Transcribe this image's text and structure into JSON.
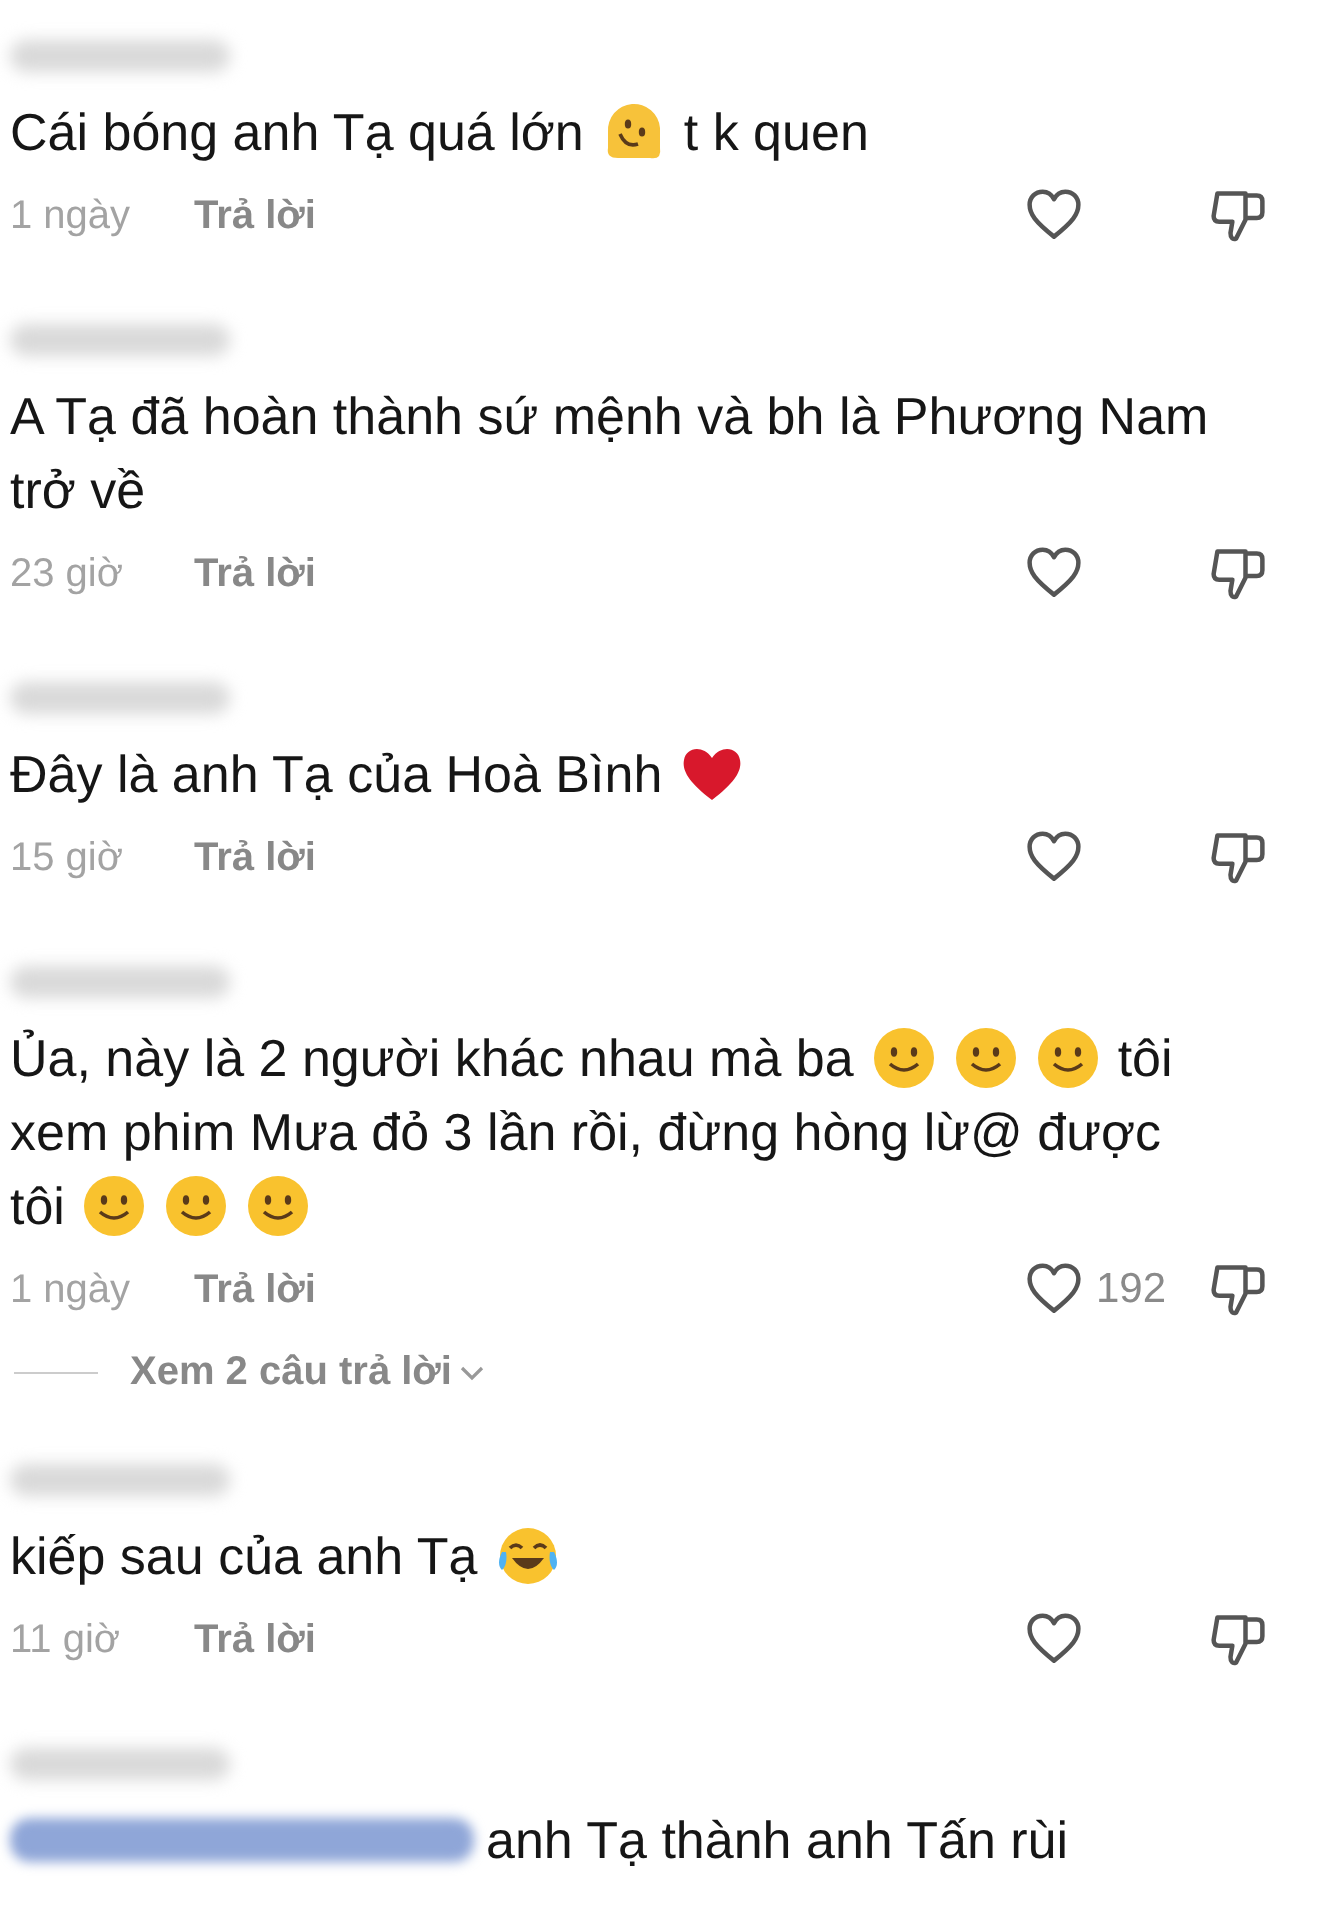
{
  "comments": [
    {
      "lines": [
        [
          {
            "kind": "text",
            "text": "Cái bóng anh Tạ quá lớn"
          },
          {
            "kind": "melting-face"
          },
          {
            "kind": "text",
            "text": "t k quen"
          }
        ]
      ],
      "time": "1 ngày",
      "reply": "Trả lời"
    },
    {
      "lines": [
        [
          {
            "kind": "text",
            "text": "A Tạ đã hoàn thành sứ mệnh và bh là Phương Nam"
          }
        ],
        [
          {
            "kind": "text",
            "text": "trở về"
          }
        ]
      ],
      "time": "23 giờ",
      "reply": "Trả lời"
    },
    {
      "lines": [
        [
          {
            "kind": "text",
            "text": "Đây là anh Tạ của Hoà Bình"
          },
          {
            "kind": "heart"
          }
        ]
      ],
      "time": "15 giờ",
      "reply": "Trả lời"
    },
    {
      "lines": [
        [
          {
            "kind": "text",
            "text": "Ủa, này là 2 người khác nhau mà ba"
          },
          {
            "kind": "smiley"
          },
          {
            "kind": "smiley"
          },
          {
            "kind": "smiley"
          },
          {
            "kind": "text",
            "text": "tôi"
          }
        ],
        [
          {
            "kind": "text",
            "text": "xem phim Mưa đỏ 3 lần rồi, đừng hòng lừ@ được"
          }
        ],
        [
          {
            "kind": "text",
            "text": "tôi"
          },
          {
            "kind": "smiley"
          },
          {
            "kind": "smiley"
          },
          {
            "kind": "smiley"
          }
        ]
      ],
      "time": "1 ngày",
      "reply": "Trả lời",
      "likes": "192",
      "view_replies": "Xem 2 câu trả lời"
    },
    {
      "lines": [
        [
          {
            "kind": "text",
            "text": "kiếp sau của anh Tạ"
          },
          {
            "kind": "laughing-face"
          }
        ]
      ],
      "time": "11 giờ",
      "reply": "Trả lời"
    },
    {
      "lines": [
        [
          {
            "kind": "blurred-mention"
          },
          {
            "kind": "text",
            "text": "anh Tạ thành anh Tấn rùi"
          }
        ]
      ]
    }
  ]
}
